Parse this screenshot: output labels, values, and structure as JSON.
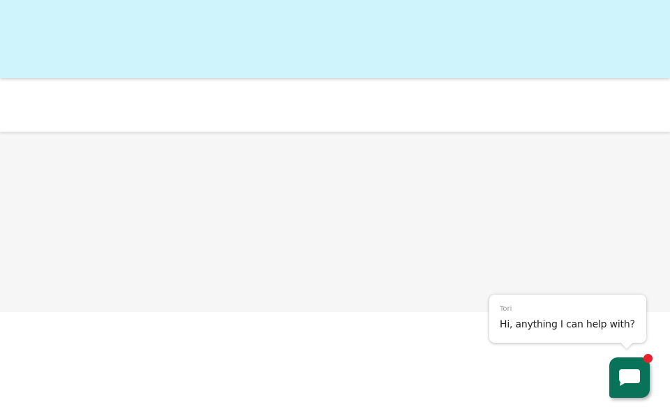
{
  "chat_widget": {
    "sender_name": "Tori",
    "message": "Hi, anything I can help with?",
    "launcher_icon": "chat-bubble-icon",
    "notification": "red-dot",
    "colors": {
      "launcher": "#087358",
      "notification": "#e8222c",
      "banner": "#cff4fc"
    }
  }
}
